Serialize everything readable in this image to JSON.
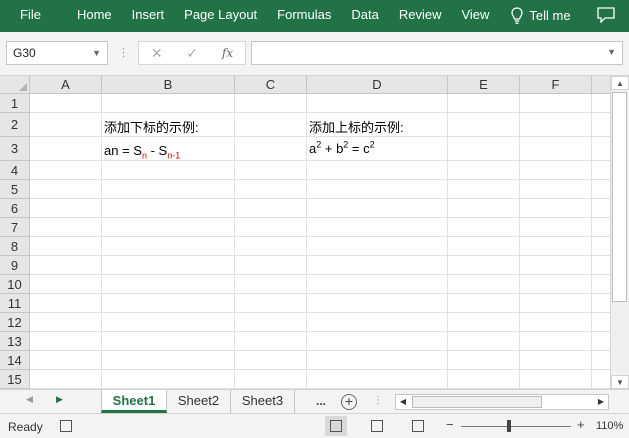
{
  "ribbon": {
    "tabs": [
      "File",
      "Home",
      "Insert",
      "Page Layout",
      "Formulas",
      "Data",
      "Review",
      "View"
    ],
    "tell_me": "Tell me",
    "tell_me_icon": "lightbulb-icon",
    "comment_icon": "comment-icon",
    "color": "#217346"
  },
  "formula_bar": {
    "name_box": "G30",
    "cancel_icon": "✕",
    "enter_icon": "✓",
    "fx_label": "fx",
    "value": ""
  },
  "columns": [
    "A",
    "B",
    "C",
    "D",
    "E",
    "F"
  ],
  "rows": [
    "1",
    "2",
    "3",
    "4",
    "5",
    "6",
    "7",
    "8",
    "9",
    "10",
    "11",
    "12",
    "13",
    "14",
    "15"
  ],
  "cells": {
    "B2": "添加下标的示例:",
    "B3": {
      "base": "an = S",
      "sub1": "n",
      "mid": " - S",
      "sub2": "n-1"
    },
    "D2": "添加上标的示例:",
    "D3": {
      "a": "a",
      "sup1": "2",
      "mid": " + b",
      "sup2": "2",
      "eq": " = c",
      "sup3": "2"
    },
    "subscript_color": "#e00000"
  },
  "sheets": {
    "tabs": [
      "Sheet1",
      "Sheet2",
      "Sheet3"
    ],
    "active": "Sheet1",
    "more": "...",
    "add": "+"
  },
  "status": {
    "ready": "Ready",
    "zoom": "110%",
    "zoom_minus": "−",
    "zoom_plus": "+"
  }
}
